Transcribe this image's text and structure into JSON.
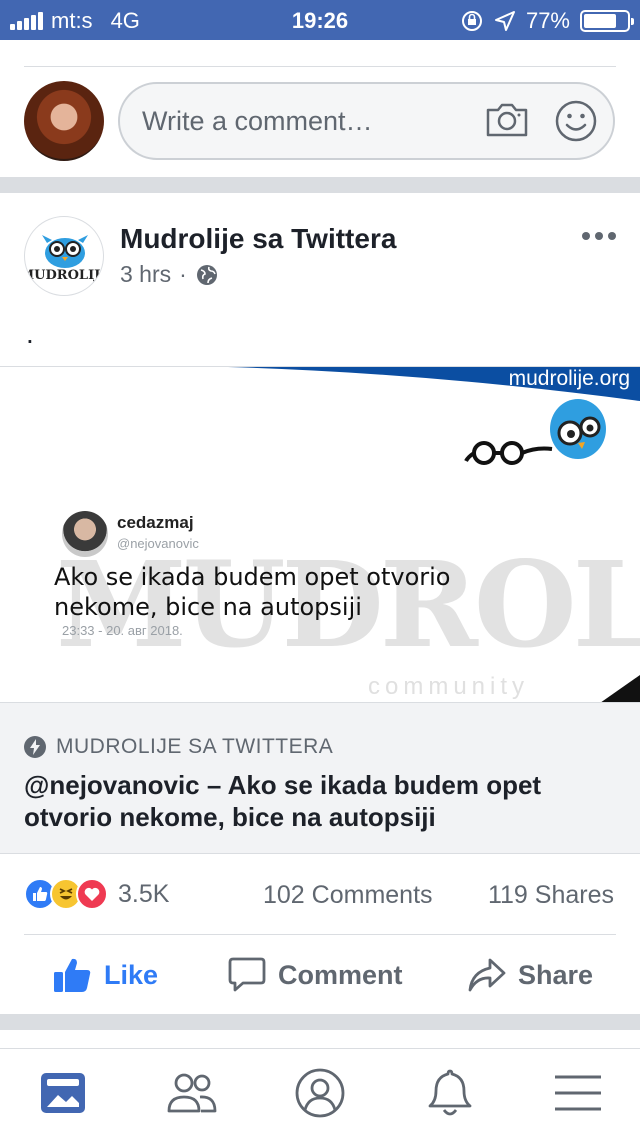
{
  "status_bar": {
    "carrier": "mt:s",
    "network": "4G",
    "time": "19:26",
    "battery": "77%",
    "battery_level": 0.77
  },
  "comment_composer": {
    "placeholder": "Write a comment…"
  },
  "post": {
    "page_name": "Mudrolije sa Twittera",
    "time_ago": "3 hrs",
    "meta_separator": "·",
    "text": ".",
    "image": {
      "site": "mudrolije.org",
      "tweet_user": "cedazmaj",
      "tweet_handle": "@nejovanovic",
      "tweet_text": "Ako se ikada budem opet otvorio nekome, bice na autopsiji",
      "tweet_date": "23:33 - 20. авг 2018.",
      "watermark": "MUDROLIJE",
      "watermark_sub": "community",
      "logo_text": "MUDROLIJE"
    },
    "link_preview": {
      "source": "MUDROLIJE SA TWITTERA",
      "title": "@nejovanovic – Ako se ikada budem opet otvorio nekome, bice na autopsiji"
    },
    "reactions_count": "3.5K",
    "comments_count": "102 Comments",
    "shares_count": "119 Shares",
    "actions": {
      "like": "Like",
      "comment": "Comment",
      "share": "Share"
    }
  },
  "colors": {
    "brand": "#4267b2",
    "like_blue": "#2f7bf6",
    "text_secondary": "#606770",
    "separator": "#dadde1"
  },
  "tab_bar": {
    "icons": [
      "news-feed-icon",
      "friends-icon",
      "profile-icon",
      "notifications-icon",
      "menu-icon"
    ]
  }
}
